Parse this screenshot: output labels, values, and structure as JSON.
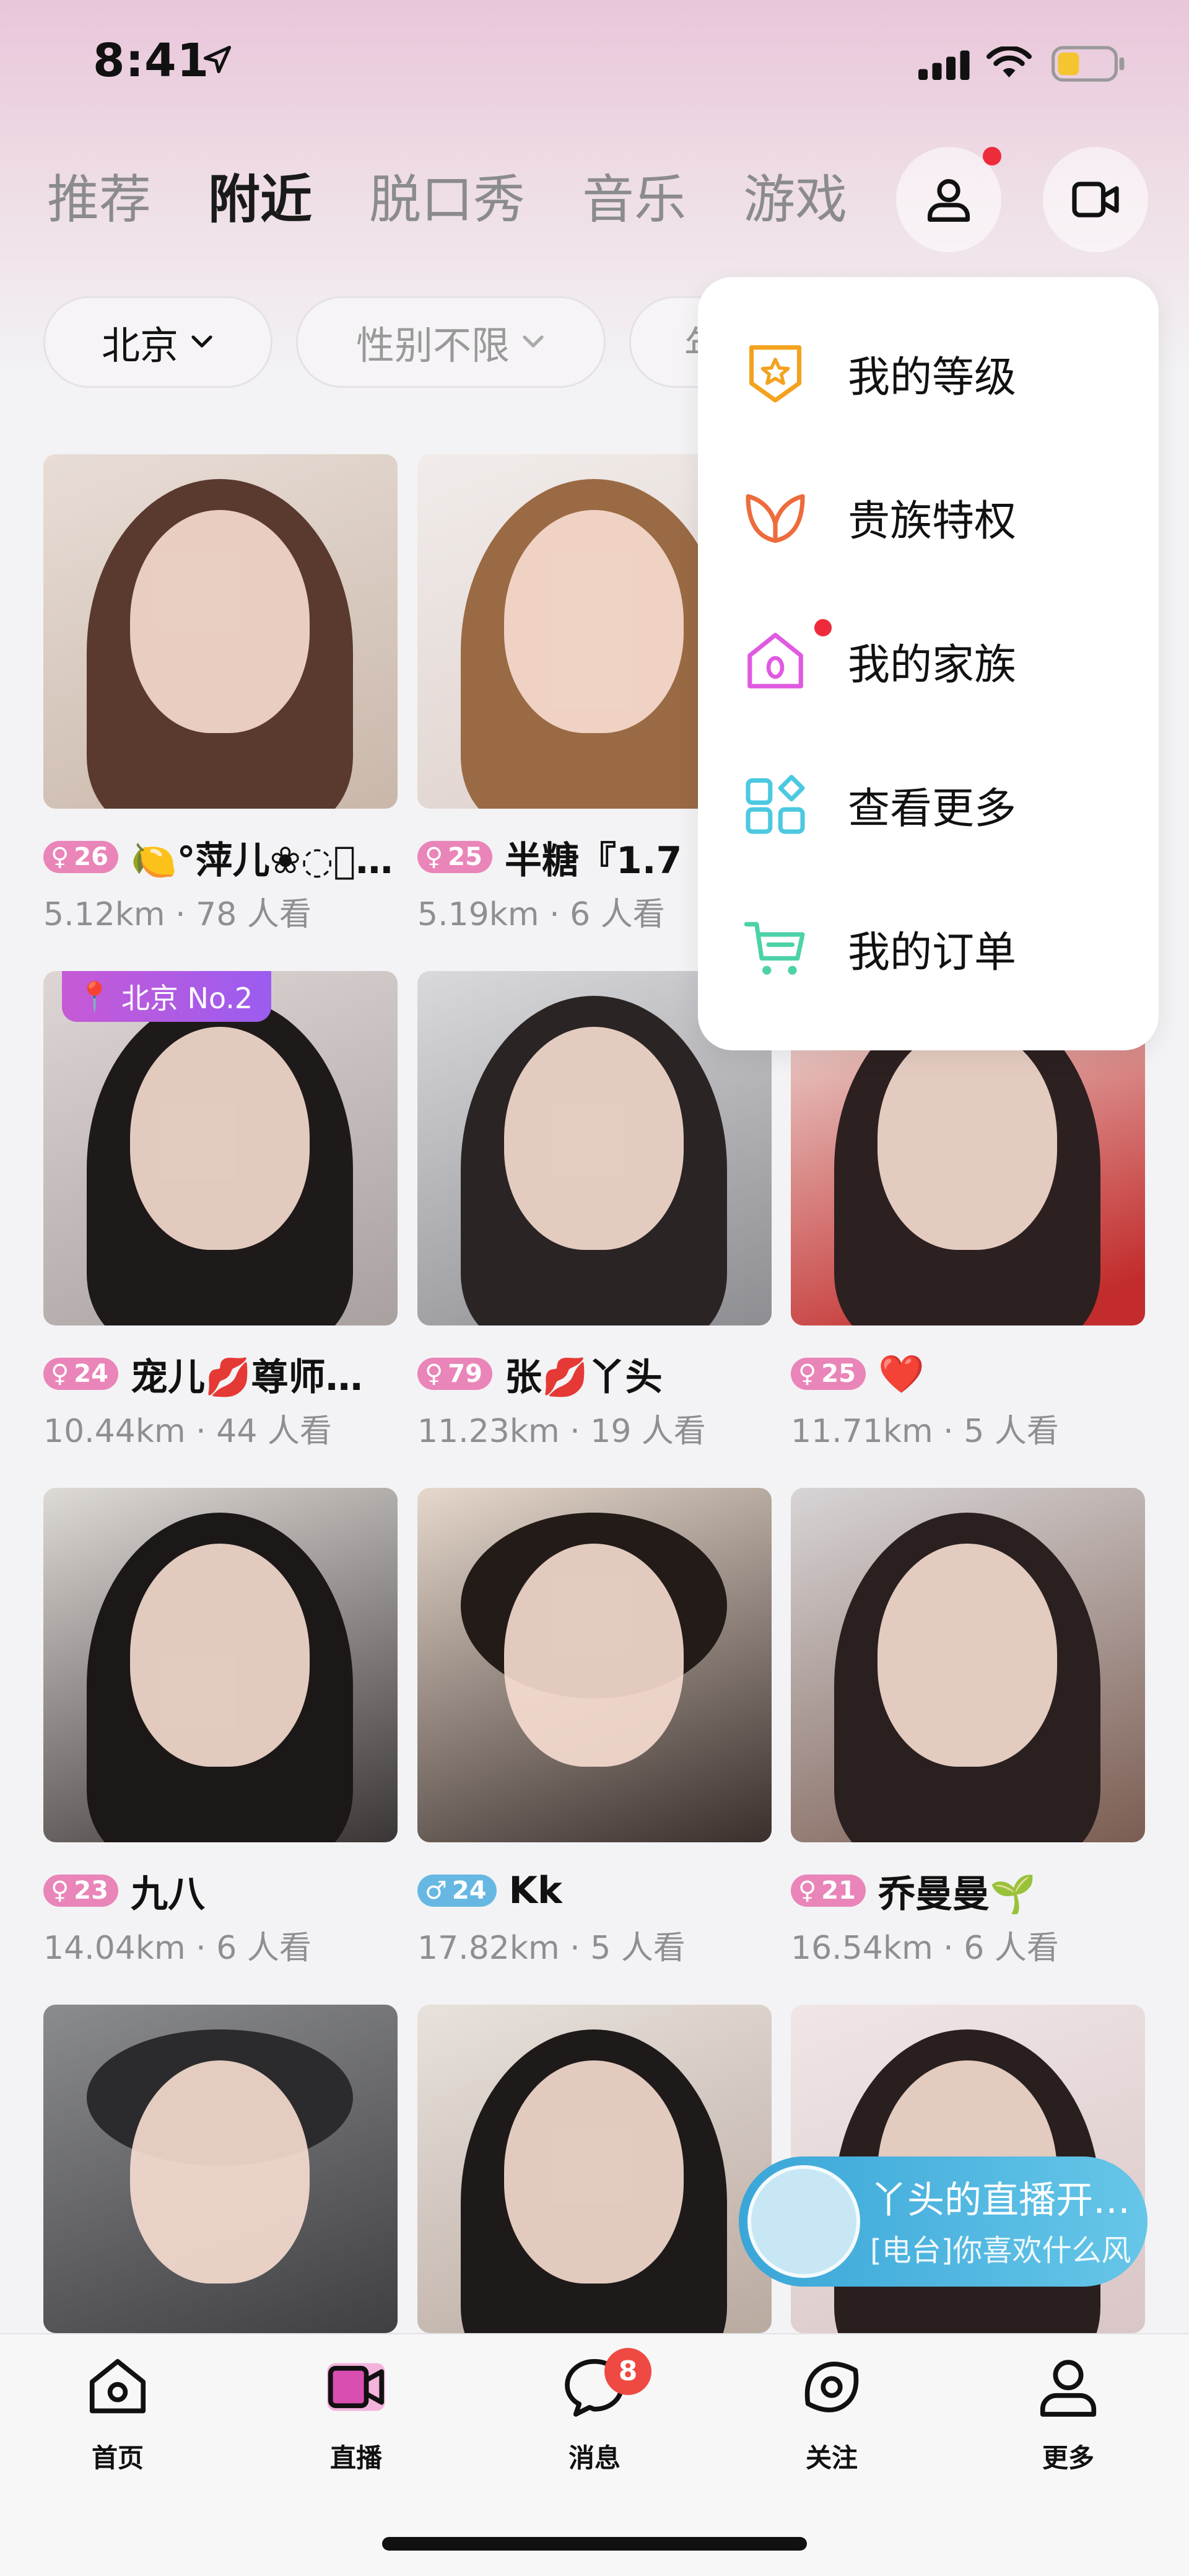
{
  "status_bar": {
    "time": "8:41",
    "location_icon": "location-arrow-icon",
    "signal_icon": "cell-signal-icon",
    "wifi_icon": "wifi-icon",
    "battery_icon": "battery-low-icon"
  },
  "tabs": [
    {
      "label": "推荐"
    },
    {
      "label": "附近"
    },
    {
      "label": "脱口秀"
    },
    {
      "label": "音乐"
    },
    {
      "label": "游戏"
    }
  ],
  "active_tab": "附近",
  "filters": {
    "city": "北京",
    "gender": "性别不限",
    "third_partial": "年"
  },
  "menu": {
    "items": [
      {
        "label": "我的等级",
        "icon": "level-star-icon"
      },
      {
        "label": "贵族特权",
        "icon": "noble-wings-icon"
      },
      {
        "label": "我的家族",
        "icon": "family-house-icon"
      },
      {
        "label": "查看更多",
        "icon": "more-apps-icon"
      },
      {
        "label": "我的订单",
        "icon": "cart-icon"
      }
    ]
  },
  "cards": [
    {
      "level": "26",
      "gender": "female",
      "name": "🍋°萍儿❀◌⃔(…",
      "distance": "5.12km",
      "viewers": "78 人看"
    },
    {
      "level": "25",
      "gender": "female",
      "name": "半糖『1.7",
      "distance": "5.19km",
      "viewers": "6 人看"
    },
    {
      "level": "24",
      "gender": "female",
      "name": "宠儿💋尊师…",
      "distance": "10.44km",
      "viewers": "44 人看",
      "tag": "北京 No.2"
    },
    {
      "level": "79",
      "gender": "female",
      "name": "张💋丫头",
      "distance": "11.23km",
      "viewers": "19 人看"
    },
    {
      "level": "25",
      "gender": "female",
      "name": "❤️",
      "distance": "11.71km",
      "viewers": "5 人看"
    },
    {
      "level": "23",
      "gender": "female",
      "name": "九八",
      "distance": "14.04km",
      "viewers": "6 人看"
    },
    {
      "level": "24",
      "gender": "male",
      "name": "Kk",
      "distance": "17.82km",
      "viewers": "5 人看"
    },
    {
      "level": "21",
      "gender": "female",
      "name": "乔曼曼🌱",
      "distance": "16.54km",
      "viewers": "6 人看"
    }
  ],
  "live_float": {
    "title": "丫头的直播开…",
    "subtitle": "[电台]你喜欢什么风"
  },
  "bottom_nav": [
    {
      "label": "首页",
      "icon": "home-icon"
    },
    {
      "label": "直播",
      "icon": "live-camera-icon"
    },
    {
      "label": "消息",
      "icon": "message-icon",
      "badge": "8"
    },
    {
      "label": "关注",
      "icon": "eye-icon"
    },
    {
      "label": "更多",
      "icon": "profile-icon"
    }
  ],
  "colors": {
    "accent_pink": "#e985b8",
    "male_blue": "#66b8e3",
    "badge_red": "#ee4a43",
    "live_cyan": "#3aa6d8"
  }
}
